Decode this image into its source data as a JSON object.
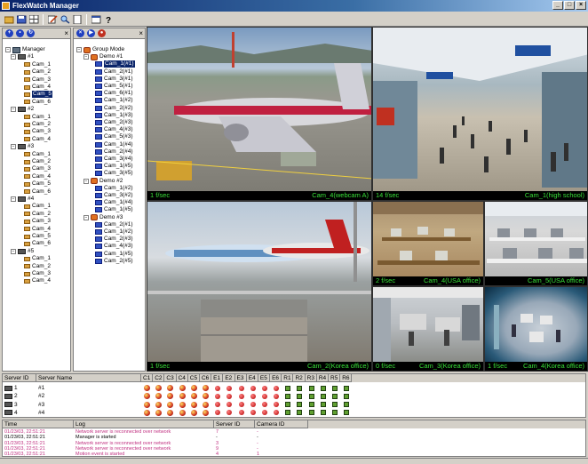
{
  "window": {
    "title": "FlexWatch Manager",
    "controls": [
      "_",
      "□",
      "×"
    ]
  },
  "toolbar": {
    "icons": [
      "open-icon",
      "save-icon",
      "layout-icon",
      "edit-icon",
      "search-icon",
      "page-icon",
      "calendar-icon",
      "help-icon"
    ]
  },
  "left_panel": {
    "root_label": "Manager",
    "servers": [
      {
        "label": "#1",
        "cams": [
          "Cam_1",
          "Cam_2",
          "Cam_3",
          "Cam_4",
          "Cam_5",
          "Cam_6"
        ],
        "selected_index": 4
      },
      {
        "label": "#2",
        "cams": [
          "Cam_1",
          "Cam_2",
          "Cam_3",
          "Cam_4"
        ]
      },
      {
        "label": "#3",
        "cams": [
          "Cam_1",
          "Cam_2",
          "Cam_3",
          "Cam_4",
          "Cam_5",
          "Cam_6"
        ]
      },
      {
        "label": "#4",
        "cams": [
          "Cam_1",
          "Cam_2",
          "Cam_3",
          "Cam_4",
          "Cam_5",
          "Cam_6"
        ]
      },
      {
        "label": "#5",
        "cams": [
          "Cam_1",
          "Cam_2",
          "Cam_3",
          "Cam_4"
        ]
      }
    ]
  },
  "middle_panel": {
    "root_label": "Group Mode",
    "groups": [
      {
        "label": "Demo #1",
        "cams": [
          "Cam_1(#1)",
          "Cam_2(#1)",
          "Cam_3(#1)",
          "Cam_5(#1)",
          "Cam_6(#1)",
          "Cam_1(#2)",
          "Cam_2(#2)",
          "Cam_1(#3)",
          "Cam_2(#3)",
          "Cam_4(#3)",
          "Cam_5(#3)",
          "Cam_1(#4)",
          "Cam_2(#4)",
          "Cam_3(#4)",
          "Cam_1(#5)",
          "Cam_3(#5)"
        ],
        "selected_index": 0
      },
      {
        "label": "Demo #2",
        "cams": [
          "Cam_1(#2)",
          "Cam_3(#2)",
          "Cam_1(#4)",
          "Cam_1(#5)"
        ]
      },
      {
        "label": "Demo #3",
        "cams": [
          "Cam_2(#1)",
          "Cam_1(#2)",
          "Cam_2(#3)",
          "Cam_4(#3)",
          "Cam_1(#5)",
          "Cam_2(#5)"
        ]
      }
    ]
  },
  "video_tiles": [
    {
      "rate": "1 f/sec",
      "name": "Cam_4(webcam A)"
    },
    {
      "rate": "14 f/sec",
      "name": "Cam_1(high school)"
    },
    {
      "rate": "1 f/sec",
      "name": "Cam_2(Korea office)"
    },
    {
      "rate": "2 f/sec",
      "name": "Cam_4(USA office)"
    },
    {
      "rate": "",
      "name": "Cam_5(USA office)"
    },
    {
      "rate": "0 f/sec",
      "name": "Cam_3(Korea office)"
    },
    {
      "rate": "1 f/sec",
      "name": "Cam_4(Korea office)"
    }
  ],
  "server_table": {
    "headers": [
      "Server ID",
      "Server Name",
      "C1",
      "C2",
      "C3",
      "C4",
      "C5",
      "C6",
      "E1",
      "E2",
      "E3",
      "E4",
      "E5",
      "E6",
      "R1",
      "R2",
      "R3",
      "R4",
      "R5",
      "R6"
    ],
    "rows": [
      {
        "id": "1",
        "name": "#1"
      },
      {
        "id": "2",
        "name": "#2"
      },
      {
        "id": "3",
        "name": "#3"
      },
      {
        "id": "4",
        "name": "#4"
      }
    ]
  },
  "log_table": {
    "headers": [
      "Time",
      "Log",
      "Server ID",
      "Camera ID"
    ],
    "rows": [
      {
        "time": "01/23/03, 22:51:21",
        "log": "Network server is reconnected over network",
        "server": "7",
        "camera": "-",
        "color": "#c03080"
      },
      {
        "time": "01/23/03, 22:51:21",
        "log": "Manager is started",
        "server": "-",
        "camera": "-",
        "color": "#000000"
      },
      {
        "time": "01/23/03, 22:51:21",
        "log": "Network server is reconnected over network",
        "server": "3",
        "camera": "-",
        "color": "#c03080"
      },
      {
        "time": "01/23/03, 22:51:21",
        "log": "Network server is reconnected over network",
        "server": "9",
        "camera": "-",
        "color": "#c03080"
      },
      {
        "time": "01/23/03, 22:51:21",
        "log": "Motion event is started",
        "server": "4",
        "camera": "1",
        "color": "#c03080"
      }
    ]
  }
}
